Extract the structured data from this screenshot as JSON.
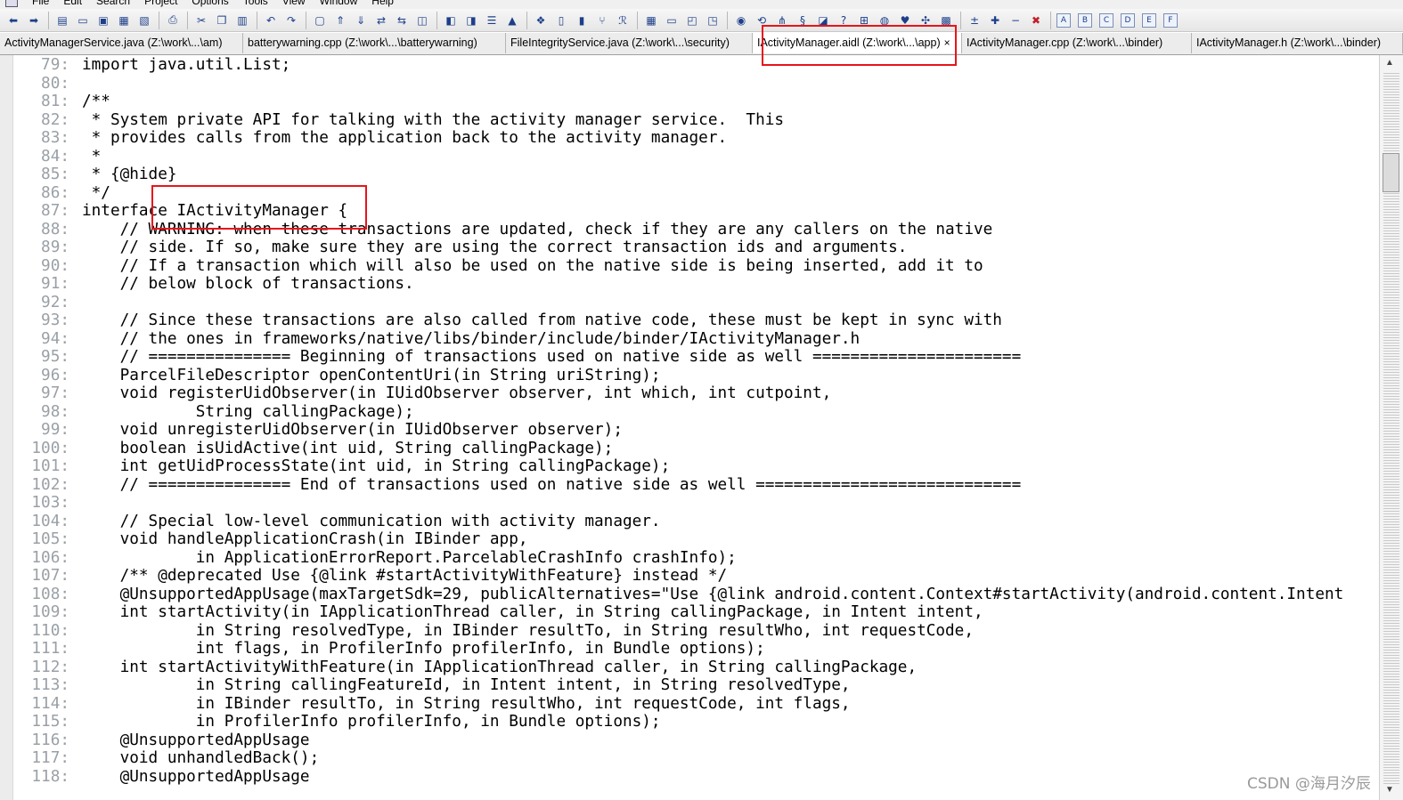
{
  "menubar": {
    "items": [
      "File",
      "Edit",
      "Search",
      "Project",
      "Options",
      "Tools",
      "View",
      "Window",
      "Help"
    ]
  },
  "toolbar": {
    "icons": [
      "back-arrow-icon",
      "forward-arrow-icon",
      "sep",
      "new-file-icon",
      "open-folder-icon",
      "save-icon",
      "save-all-icon",
      "close-file-icon",
      "sep",
      "print-icon",
      "sep",
      "cut-icon",
      "copy-icon",
      "paste-icon",
      "sep",
      "undo-icon",
      "redo-icon",
      "sep",
      "find-icon",
      "jump-up-icon",
      "jump-down-icon",
      "replace-icon",
      "xy-compare-icon",
      "browse-web-icon",
      "sep",
      "bookmark-prev-icon",
      "bookmark-next-icon",
      "list-icon",
      "bookmark-icon",
      "sep",
      "symbol-icon",
      "window-icon",
      "book-icon",
      "fork-icon",
      "regex-icon",
      "sep",
      "grid-icon",
      "panel-icon",
      "split-icon",
      "tile-icon",
      "sep",
      "project-icon",
      "sync-icon",
      "tree-icon",
      "script-icon",
      "module-icon",
      "help-icon",
      "graph-icon",
      "globe-icon",
      "bird-icon",
      "puzzle-icon",
      "table-icon",
      "sep",
      "increase-icon",
      "add-line-icon",
      "remove-line-icon",
      "delete-icon",
      "sep",
      "macro-a-icon",
      "macro-b-icon",
      "macro-c-icon",
      "macro-d-icon",
      "macro-e-icon",
      "macro-f-icon"
    ]
  },
  "tabs": [
    {
      "label": "ActivityManagerService.java (Z:\\work\\...\\am)",
      "active": false
    },
    {
      "label": "batterywarning.cpp (Z:\\work\\...\\batterywarning)",
      "active": false
    },
    {
      "label": "FileIntegrityService.java (Z:\\work\\...\\security)",
      "active": false
    },
    {
      "label": "IActivityManager.aidl (Z:\\work\\...\\app)",
      "active": true,
      "close": "×"
    },
    {
      "label": "IActivityManager.cpp (Z:\\work\\...\\binder)",
      "active": false
    },
    {
      "label": "IActivityManager.h (Z:\\work\\...\\binder)",
      "active": false
    }
  ],
  "editor": {
    "lines": [
      {
        "n": "79:",
        "t": "import java.util.List;"
      },
      {
        "n": "80:",
        "t": ""
      },
      {
        "n": "81:",
        "t": "/**"
      },
      {
        "n": "82:",
        "t": " * System private API for talking with the activity manager service.  This"
      },
      {
        "n": "83:",
        "t": " * provides calls from the application back to the activity manager."
      },
      {
        "n": "84:",
        "t": " *"
      },
      {
        "n": "85:",
        "t": " * {@hide}"
      },
      {
        "n": "86:",
        "t": " */"
      },
      {
        "n": "87:",
        "t": "interface IActivityManager {"
      },
      {
        "n": "88:",
        "t": "    // WARNING: when these transactions are updated, check if they are any callers on the native"
      },
      {
        "n": "89:",
        "t": "    // side. If so, make sure they are using the correct transaction ids and arguments."
      },
      {
        "n": "90:",
        "t": "    // If a transaction which will also be used on the native side is being inserted, add it to"
      },
      {
        "n": "91:",
        "t": "    // below block of transactions."
      },
      {
        "n": "92:",
        "t": ""
      },
      {
        "n": "93:",
        "t": "    // Since these transactions are also called from native code, these must be kept in sync with"
      },
      {
        "n": "94:",
        "t": "    // the ones in frameworks/native/libs/binder/include/binder/IActivityManager.h"
      },
      {
        "n": "95:",
        "t": "    // =============== Beginning of transactions used on native side as well ======================"
      },
      {
        "n": "96:",
        "t": "    ParcelFileDescriptor openContentUri(in String uriString);"
      },
      {
        "n": "97:",
        "t": "    void registerUidObserver(in IUidObserver observer, int which, int cutpoint,"
      },
      {
        "n": "98:",
        "t": "            String callingPackage);"
      },
      {
        "n": "99:",
        "t": "    void unregisterUidObserver(in IUidObserver observer);"
      },
      {
        "n": "100:",
        "t": "    boolean isUidActive(int uid, String callingPackage);"
      },
      {
        "n": "101:",
        "t": "    int getUidProcessState(int uid, in String callingPackage);"
      },
      {
        "n": "102:",
        "t": "    // =============== End of transactions used on native side as well ============================"
      },
      {
        "n": "103:",
        "t": ""
      },
      {
        "n": "104:",
        "t": "    // Special low-level communication with activity manager."
      },
      {
        "n": "105:",
        "t": "    void handleApplicationCrash(in IBinder app,"
      },
      {
        "n": "106:",
        "t": "            in ApplicationErrorReport.ParcelableCrashInfo crashInfo);"
      },
      {
        "n": "107:",
        "t": "    /** @deprecated Use {@link #startActivityWithFeature} instead */"
      },
      {
        "n": "108:",
        "t": "    @UnsupportedAppUsage(maxTargetSdk=29, publicAlternatives=\"Use {@link android.content.Context#startActivity(android.content.Intent"
      },
      {
        "n": "109:",
        "t": "    int startActivity(in IApplicationThread caller, in String callingPackage, in Intent intent,"
      },
      {
        "n": "110:",
        "t": "            in String resolvedType, in IBinder resultTo, in String resultWho, int requestCode,"
      },
      {
        "n": "111:",
        "t": "            int flags, in ProfilerInfo profilerInfo, in Bundle options);"
      },
      {
        "n": "112:",
        "t": "    int startActivityWithFeature(in IApplicationThread caller, in String callingPackage,"
      },
      {
        "n": "113:",
        "t": "            in String callingFeatureId, in Intent intent, in String resolvedType,"
      },
      {
        "n": "114:",
        "t": "            in IBinder resultTo, in String resultWho, int requestCode, int flags,"
      },
      {
        "n": "115:",
        "t": "            in ProfilerInfo profilerInfo, in Bundle options);"
      },
      {
        "n": "116:",
        "t": "    @UnsupportedAppUsage"
      },
      {
        "n": "117:",
        "t": "    void unhandledBack();"
      },
      {
        "n": "118:",
        "t": "    @UnsupportedAppUsage"
      }
    ]
  },
  "scrollbar": {
    "up": "▲",
    "down": "▼"
  },
  "watermark": "CSDN @海月汐辰",
  "colors": {
    "annotation": "#e8141a",
    "line_number": "#9aa0a6"
  }
}
